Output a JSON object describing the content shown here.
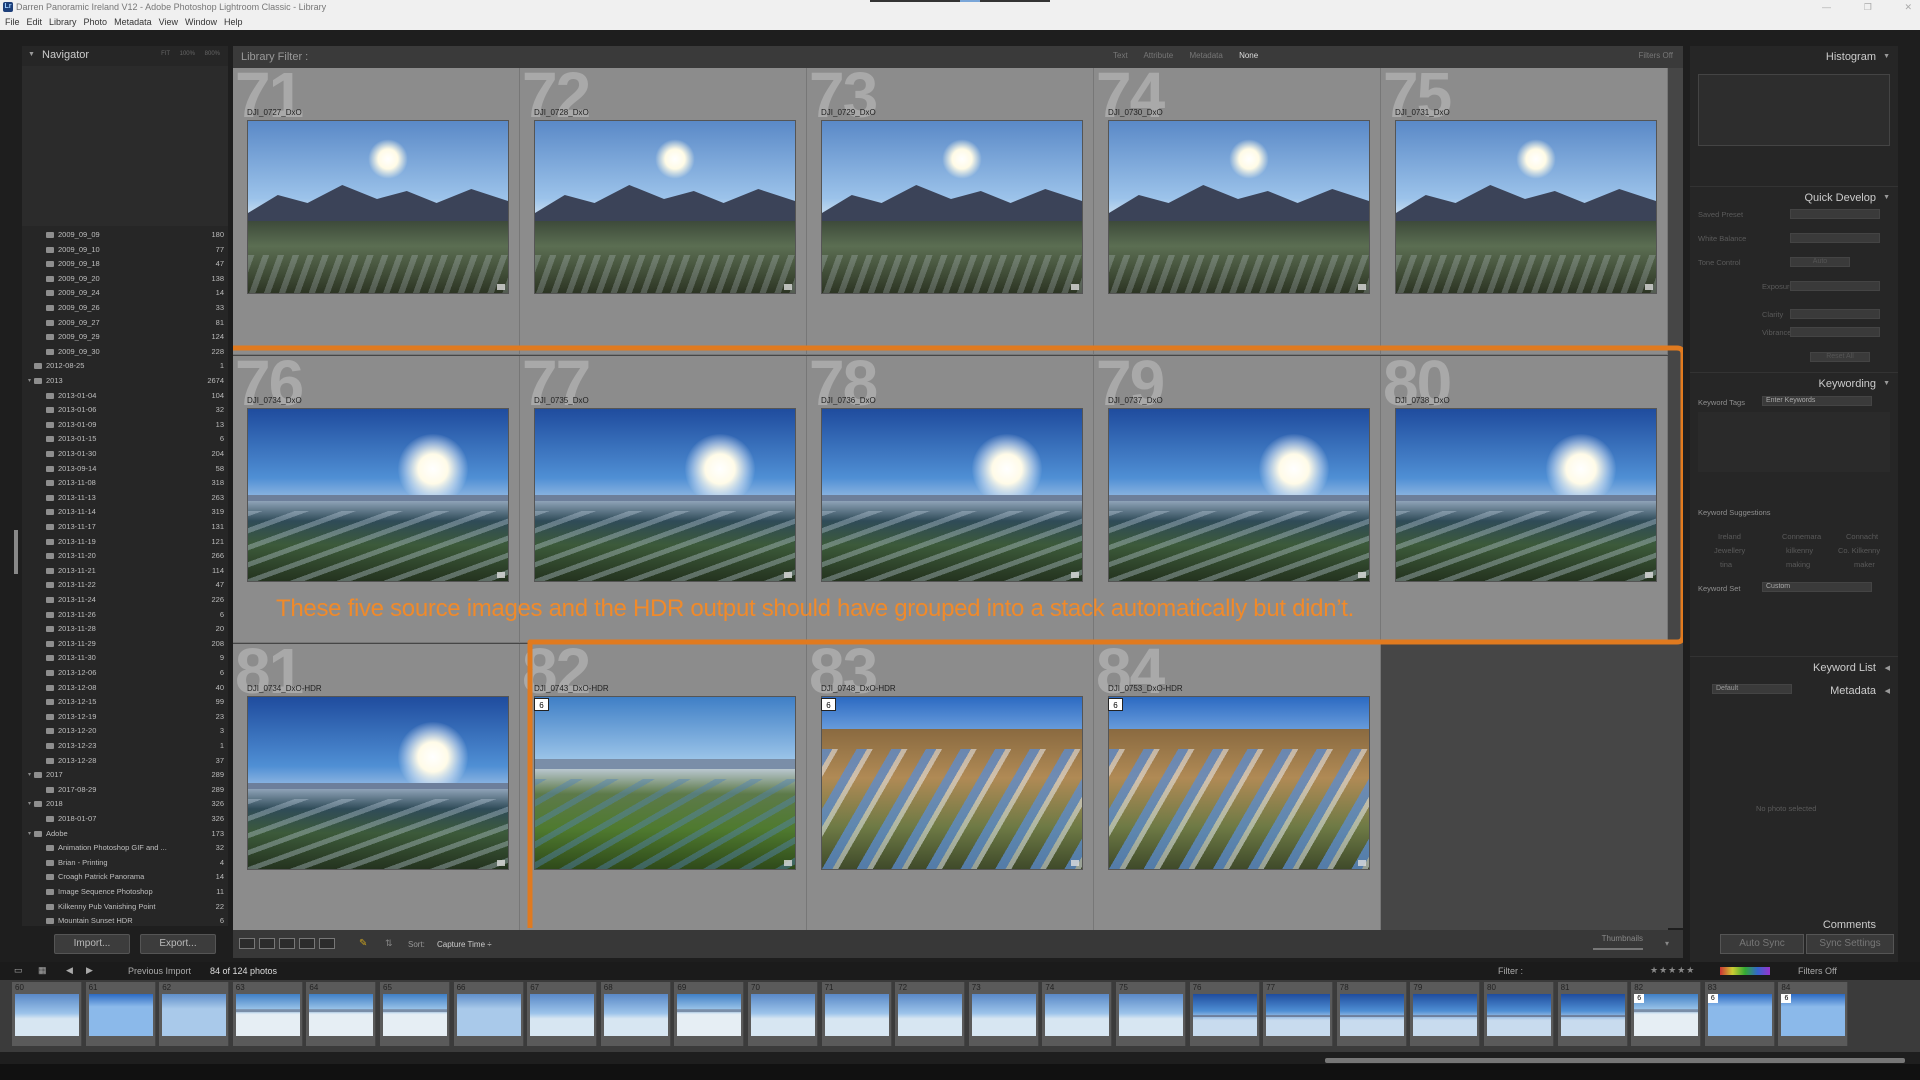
{
  "window": {
    "title": "Darren Panoramic Ireland V12 - Adobe Photoshop Lightroom Classic - Library",
    "controls": [
      "—",
      "❐",
      "✕"
    ]
  },
  "menu": [
    "File",
    "Edit",
    "Library",
    "Photo",
    "Metadata",
    "View",
    "Window",
    "Help"
  ],
  "navigator": {
    "title": "Navigator",
    "zoom_options": "FIT 100% 800%"
  },
  "folders": [
    {
      "name": "2009_09_09",
      "count": "180",
      "level": 2
    },
    {
      "name": "2009_09_10",
      "count": "77",
      "level": 2
    },
    {
      "name": "2009_09_18",
      "count": "47",
      "level": 2
    },
    {
      "name": "2009_09_20",
      "count": "138",
      "level": 2
    },
    {
      "name": "2009_09_24",
      "count": "14",
      "level": 2
    },
    {
      "name": "2009_09_26",
      "count": "33",
      "level": 2
    },
    {
      "name": "2009_09_27",
      "count": "81",
      "level": 2
    },
    {
      "name": "2009_09_29",
      "count": "124",
      "level": 2
    },
    {
      "name": "2009_09_30",
      "count": "228",
      "level": 2
    },
    {
      "name": "2012-08-25",
      "count": "1",
      "level": 1
    },
    {
      "name": "2013",
      "count": "2674",
      "level": 1,
      "expanded": true
    },
    {
      "name": "2013-01-04",
      "count": "104",
      "level": 2
    },
    {
      "name": "2013-01-06",
      "count": "32",
      "level": 2
    },
    {
      "name": "2013-01-09",
      "count": "13",
      "level": 2
    },
    {
      "name": "2013-01-15",
      "count": "6",
      "level": 2
    },
    {
      "name": "2013-01-30",
      "count": "204",
      "level": 2
    },
    {
      "name": "2013-09-14",
      "count": "58",
      "level": 2
    },
    {
      "name": "2013-11-08",
      "count": "318",
      "level": 2
    },
    {
      "name": "2013-11-13",
      "count": "263",
      "level": 2
    },
    {
      "name": "2013-11-14",
      "count": "319",
      "level": 2
    },
    {
      "name": "2013-11-17",
      "count": "131",
      "level": 2
    },
    {
      "name": "2013-11-19",
      "count": "121",
      "level": 2
    },
    {
      "name": "2013-11-20",
      "count": "266",
      "level": 2
    },
    {
      "name": "2013-11-21",
      "count": "114",
      "level": 2
    },
    {
      "name": "2013-11-22",
      "count": "47",
      "level": 2
    },
    {
      "name": "2013-11-24",
      "count": "226",
      "level": 2
    },
    {
      "name": "2013-11-26",
      "count": "6",
      "level": 2
    },
    {
      "name": "2013-11-28",
      "count": "20",
      "level": 2
    },
    {
      "name": "2013-11-29",
      "count": "208",
      "level": 2
    },
    {
      "name": "2013-11-30",
      "count": "9",
      "level": 2
    },
    {
      "name": "2013-12-06",
      "count": "6",
      "level": 2
    },
    {
      "name": "2013-12-08",
      "count": "40",
      "level": 2
    },
    {
      "name": "2013-12-15",
      "count": "99",
      "level": 2
    },
    {
      "name": "2013-12-19",
      "count": "23",
      "level": 2
    },
    {
      "name": "2013-12-20",
      "count": "3",
      "level": 2
    },
    {
      "name": "2013-12-23",
      "count": "1",
      "level": 2
    },
    {
      "name": "2013-12-28",
      "count": "37",
      "level": 2
    },
    {
      "name": "2017",
      "count": "289",
      "level": 1,
      "expanded": true
    },
    {
      "name": "2017-08-29",
      "count": "289",
      "level": 2
    },
    {
      "name": "2018",
      "count": "326",
      "level": 1,
      "expanded": true
    },
    {
      "name": "2018-01-07",
      "count": "326",
      "level": 2
    },
    {
      "name": "Adobe",
      "count": "173",
      "level": 1,
      "expanded": true
    },
    {
      "name": "Animation Photoshop GIF and ...",
      "count": "32",
      "level": 2
    },
    {
      "name": "Brian - Printing",
      "count": "4",
      "level": 2
    },
    {
      "name": "Croagh Patrick Panorama",
      "count": "14",
      "level": 2
    },
    {
      "name": "Image Sequence Photoshop",
      "count": "11",
      "level": 2
    },
    {
      "name": "Kilkenny Pub Vanishing Point",
      "count": "22",
      "level": 2
    },
    {
      "name": "Mountain Sunset HDR",
      "count": "6",
      "level": 2
    }
  ],
  "left_buttons": {
    "import": "Import...",
    "export": "Export..."
  },
  "library_filter": {
    "label": "Library Filter :",
    "options": [
      "Text",
      "Attribute",
      "Metadata",
      "None"
    ],
    "selected": "None",
    "status": "Filters Off"
  },
  "grid": [
    {
      "num": "71",
      "file": "DJI_0727_DxO",
      "scene": "mountain"
    },
    {
      "num": "72",
      "file": "DJI_0728_DxO",
      "scene": "mountain"
    },
    {
      "num": "73",
      "file": "DJI_0729_DxO",
      "scene": "mountain"
    },
    {
      "num": "74",
      "file": "DJI_0730_DxO",
      "scene": "mountain"
    },
    {
      "num": "75",
      "file": "DJI_0731_DxO",
      "scene": "mountain"
    },
    {
      "num": "76",
      "file": "DJI_0734_DxO",
      "scene": "sunfields"
    },
    {
      "num": "77",
      "file": "DJI_0735_DxO",
      "scene": "sunfields"
    },
    {
      "num": "78",
      "file": "DJI_0736_DxO",
      "scene": "sunfields"
    },
    {
      "num": "79",
      "file": "DJI_0737_DxO",
      "scene": "sunfields"
    },
    {
      "num": "80",
      "file": "DJI_0738_DxO",
      "scene": "sunfields"
    },
    {
      "num": "81",
      "file": "DJI_0734_DxO-HDR",
      "scene": "sunfields"
    },
    {
      "num": "82",
      "file": "DJI_0743_DxO-HDR",
      "scene": "green",
      "badge": "6"
    },
    {
      "num": "83",
      "file": "DJI_0748_DxO-HDR",
      "scene": "snowhill",
      "badge": "6"
    },
    {
      "num": "84",
      "file": "DJI_0753_DxO-HDR",
      "scene": "snowhill",
      "badge": "6"
    }
  ],
  "annotation": "These five source images and the HDR output should have grouped into a stack automatically but didn’t.",
  "toolbar": {
    "sort_label": "Sort:",
    "sort_value": "Capture Time ÷",
    "thumbnails_label": "Thumbnails"
  },
  "right_panel": {
    "histogram": "Histogram",
    "quick_develop": "Quick Develop",
    "qd_rows": [
      "Saved Preset",
      "White Balance",
      "Tone Control",
      "Exposure",
      "Clarity",
      "Vibrance"
    ],
    "auto": "Auto",
    "reset_all": "Reset All",
    "keywording": "Keywording",
    "keyword_tags_label": "Keyword Tags",
    "keyword_tags_value": "Enter Keywords",
    "keyword_suggestions": "Keyword Suggestions",
    "suggestions": [
      "Ireland",
      "Connemara",
      "Connacht",
      "Jewellery",
      "kilkenny",
      "Co. Kilkenny",
      "tina",
      "making",
      "maker"
    ],
    "keyword_set_label": "Keyword Set",
    "keyword_set_value": "Custom",
    "keyword_list": "Keyword List",
    "metadata": "Metadata",
    "metadata_preset": "Default",
    "no_photo": "No photo selected",
    "comments": "Comments",
    "auto_sync": "Auto Sync",
    "sync_settings": "Sync Settings"
  },
  "filmstrip_bar": {
    "source": "Previous Import",
    "count": "84 of 124 photos",
    "filter_label": "Filter :",
    "filters_off": "Filters Off"
  },
  "filmstrip": [
    {
      "num": "60",
      "scene": "mountain"
    },
    {
      "num": "61",
      "scene": "snowhill"
    },
    {
      "num": "62",
      "scene": "brown"
    },
    {
      "num": "63",
      "scene": "green"
    },
    {
      "num": "64",
      "scene": "green"
    },
    {
      "num": "65",
      "scene": "green"
    },
    {
      "num": "66",
      "scene": "brown"
    },
    {
      "num": "67",
      "scene": "mountain"
    },
    {
      "num": "68",
      "scene": "mountain"
    },
    {
      "num": "69",
      "scene": "green"
    },
    {
      "num": "70",
      "scene": "mountain"
    },
    {
      "num": "71",
      "scene": "mountain"
    },
    {
      "num": "72",
      "scene": "mountain"
    },
    {
      "num": "73",
      "scene": "mountain"
    },
    {
      "num": "74",
      "scene": "mountain"
    },
    {
      "num": "75",
      "scene": "mountain"
    },
    {
      "num": "76",
      "scene": "sunfields"
    },
    {
      "num": "77",
      "scene": "sunfields"
    },
    {
      "num": "78",
      "scene": "sunfields"
    },
    {
      "num": "79",
      "scene": "sunfields"
    },
    {
      "num": "80",
      "scene": "sunfields"
    },
    {
      "num": "81",
      "scene": "sunfields"
    },
    {
      "num": "82",
      "scene": "green",
      "badge": "6"
    },
    {
      "num": "83",
      "scene": "snowhill",
      "badge": "6"
    },
    {
      "num": "84",
      "scene": "snowhill",
      "badge": "6"
    }
  ],
  "colors": {
    "annotation": "#e07a1f",
    "cell_bg": "#8c8c8c",
    "panel_bg": "#262626"
  }
}
